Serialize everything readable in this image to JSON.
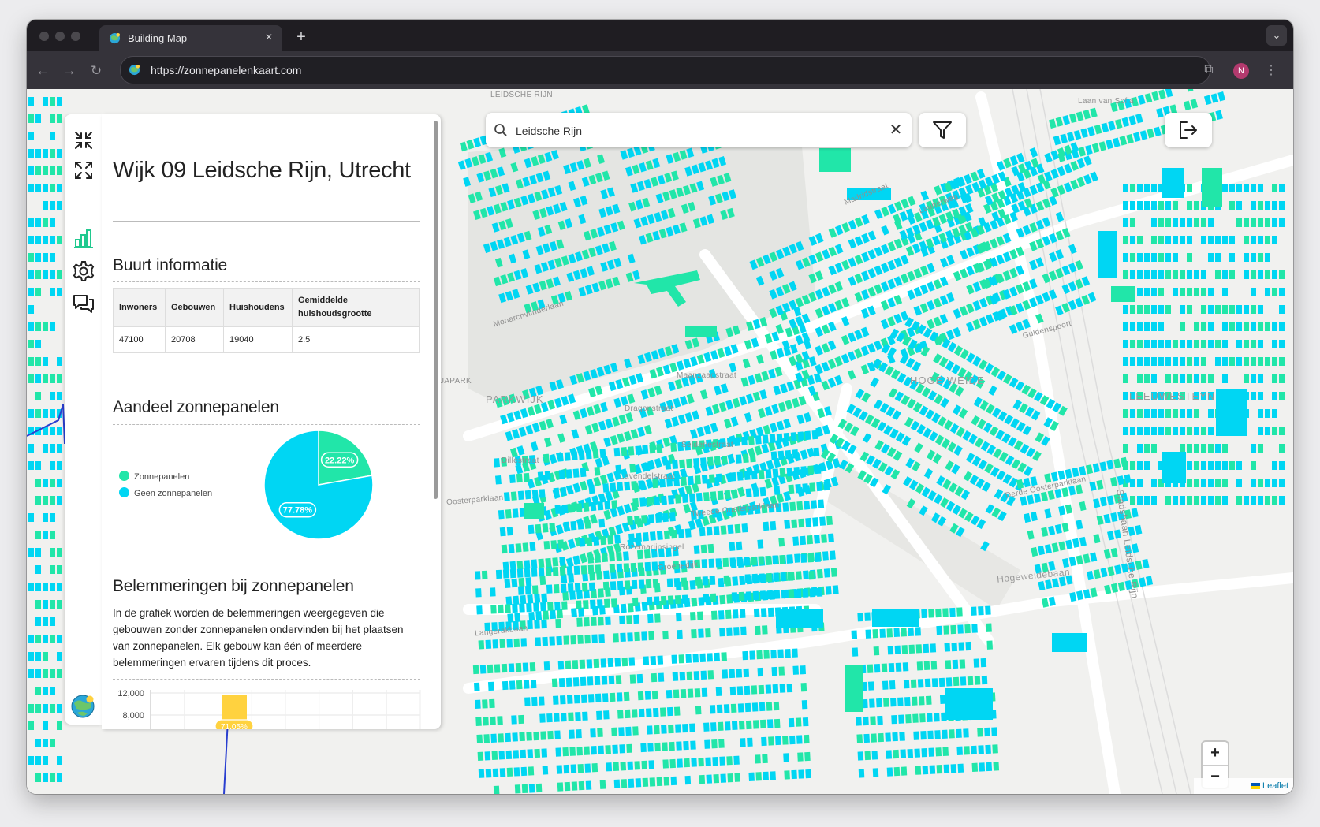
{
  "browser": {
    "tab_title": "Building Map",
    "url": "https://zonnepanelenkaart.com",
    "profile_initial": "N"
  },
  "search": {
    "value": "Leidsche Rijn"
  },
  "panel": {
    "title": "Wijk 09 Leidsche Rijn, Utrecht",
    "buurt_heading": "Buurt informatie",
    "table": {
      "headers": [
        "Inwoners",
        "Gebouwen",
        "Huishoudens",
        "Gemiddelde huishoudsgrootte"
      ],
      "rows": [
        [
          "47100",
          "20708",
          "19040",
          "2.5"
        ]
      ]
    },
    "aandeel_heading": "Aandeel zonnepanelen",
    "belemmeringen_heading": "Belemmeringen bij zonnepanelen",
    "belemmeringen_text": "In de grafiek worden de belemmeringen weergegeven die gebouwen zonder zonnepanelen ondervinden bij het plaatsen van zonnepanelen. Elk gebouw kan één of meerdere belemmeringen ervaren tijdens dit proces."
  },
  "chart_data": [
    {
      "type": "pie",
      "labels": [
        "Zonnepanelen",
        "Geen zonnepanelen"
      ],
      "values": [
        22.22,
        77.78
      ],
      "data_labels": [
        "22.22%",
        "77.78%"
      ],
      "colors": [
        "#21e6a9",
        "#00d6f3"
      ],
      "legend": "left"
    },
    {
      "type": "bar",
      "y_ticks": [
        "12,000",
        "8,000"
      ],
      "visible_bar_label": "71.05%",
      "bar_color": "#ffd23f"
    }
  ],
  "map": {
    "labels": {
      "parkwijk": "PARKWIJK",
      "hoge_weide": "HOGE WEIDE",
      "leeuwesteyn": "LEEUWESTEYN",
      "hogeweidebaan": "Hogeweidebaan",
      "stadsbaan": "Stadsbaan Leidsche Rijn",
      "langerakbaan": "Langerakbaan",
      "groenedijk": "Groenedijk",
      "rozemarijnsingel": "Rozemarijnsingel",
      "tweede_oosterparklaan": "Tweede Oosterparklaan",
      "laurierweg": "Laurierweg",
      "madridstraat": "Madridstraat",
      "monarchvlinderlaan": "Monarchvlinderlaan",
      "maanzaadstraat": "Maanzaadstraat",
      "dragonstraat": "Dragonstraat",
      "selderiestraat": "Selderiestraat",
      "lavendelstraat": "Lavendelstraat",
      "dillestraat": "Dillestraat",
      "oosterparklaan": "Oosterparklaan",
      "leidsche_rijn_top": "LEIDSCHE RIJN",
      "japark": "JAPARK",
      "laan_van_sofia": "Laan van Sofia",
      "guldenspoort": "Guldenspoort",
      "derde_oosterparklaan": "Derde Oosterparklaan"
    },
    "attribution": "Leaflet",
    "building_colors": {
      "solar": "#21e6a9",
      "no_solar": "#00d6f3"
    }
  }
}
